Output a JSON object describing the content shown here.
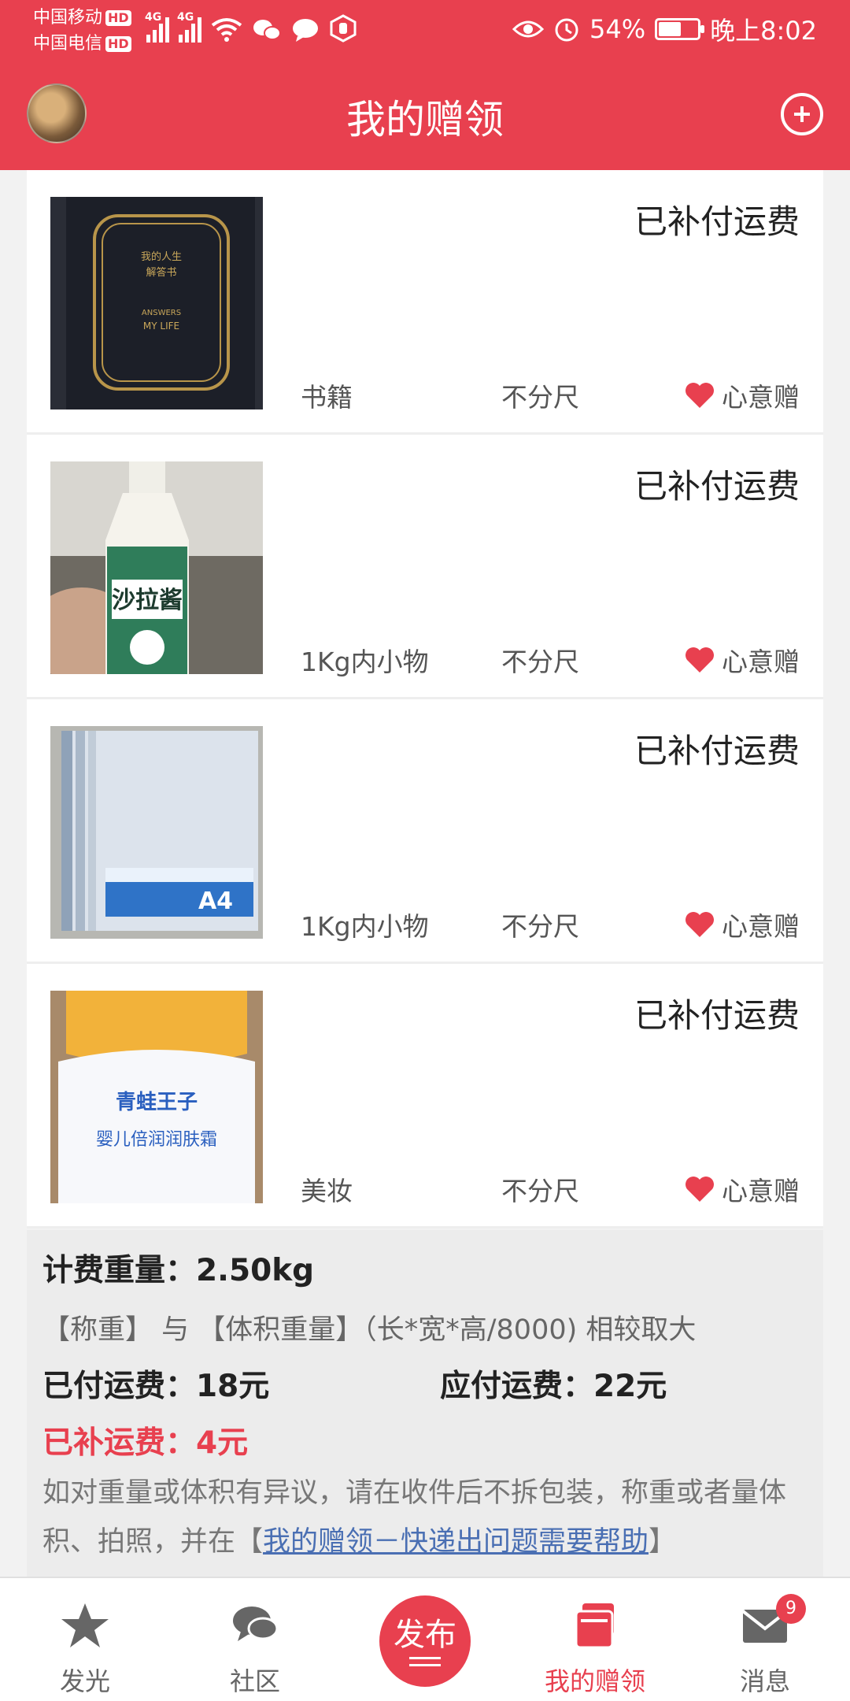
{
  "status_bar": {
    "carrier1": "中国移动",
    "carrier2": "中国电信",
    "hd": "HD",
    "net1": "4G",
    "net2": "4G",
    "battery": "54%",
    "battery_level": 0.54,
    "time": "晚上8:02"
  },
  "app_bar": {
    "title": "我的赠领"
  },
  "items": [
    {
      "status": "已补付运费",
      "category": "书籍",
      "size": "不分尺",
      "gift_type": "心意赠",
      "image": "book"
    },
    {
      "status": "已补付运费",
      "category": "1Kg内小物",
      "size": "不分尺",
      "gift_type": "心意赠",
      "image": "salad-dressing"
    },
    {
      "status": "已补付运费",
      "category": "1Kg内小物",
      "size": "不分尺",
      "gift_type": "心意赠",
      "image": "a4-folders"
    },
    {
      "status": "已补付运费",
      "category": "美妆",
      "size": "不分尺",
      "gift_type": "心意赠",
      "image": "baby-cream"
    }
  ],
  "fee": {
    "weight": "计费重量：2.50kg",
    "note": "【称重】 与 【体积重量】（长*宽*高/8000) 相较取大",
    "paid": "已付运费：18元",
    "due": "应付运费：22元",
    "refund": "已补运费：4元",
    "help_text": "如对重量或体积有异议，请在收件后不拆包装，称重或者量体积、拍照，并在【",
    "help_link": "我的赠领－快递出问题需要帮助",
    "help_end": "】"
  },
  "tabs": {
    "tab1": "发光",
    "tab2": "社区",
    "publish": "发布",
    "tab4": "我的赠领",
    "tab5": "消息",
    "badge": "9"
  },
  "colors": {
    "brand": "#e8404f",
    "link": "#4a6fb3"
  },
  "book_cover": {
    "line1": "我的人生",
    "line2": "解答书",
    "line3": "ANSWERS",
    "line4": "MY LIFE"
  },
  "bottle_label": "沙拉酱",
  "folder_label": "A4",
  "cream_label": {
    "brand": "青蛙王子",
    "product": "婴儿倍润润肤霜"
  }
}
